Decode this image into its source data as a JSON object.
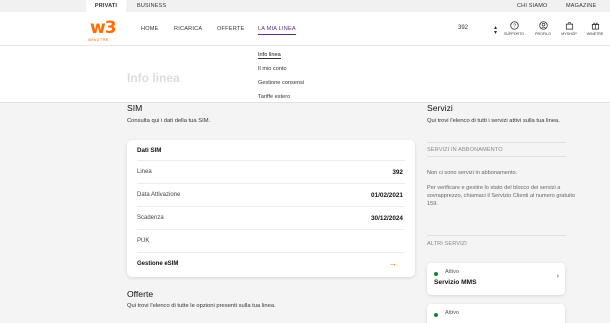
{
  "topbar": {
    "privati": "PRIVATI",
    "business": "BUSINESS",
    "chi_siamo": "CHI SIAMO",
    "magazine": "MAGAZINE"
  },
  "logo": {
    "mark": "w3",
    "word": "WINDTRE"
  },
  "nav": {
    "home": "HOME",
    "ricarica": "RICARICA",
    "offerte": "OFFERTE",
    "mia_linea": "LA MIA LINEA"
  },
  "number_selector": {
    "value": "392"
  },
  "icons": {
    "supporto": "SUPPORTO",
    "profilo": "PROFILO",
    "myshop": "MYSHOP",
    "winetre": "WINETRE"
  },
  "dropdown": {
    "items": [
      "Info linea",
      "Il mio conto",
      "Gestione consensi",
      "Tariffe estero"
    ],
    "selected": "Info linea"
  },
  "page_title_ghost": "Info linea",
  "sim": {
    "title": "SIM",
    "subtitle": "Consulta qui i dati della tua SIM.",
    "card_title": "Dati SIM",
    "rows": [
      {
        "label": "Linea",
        "value": "392"
      },
      {
        "label": "Data Attivazione",
        "value": "01/02/2021"
      },
      {
        "label": "Scadenza",
        "value": "30/12/2024"
      },
      {
        "label": "PUK",
        "value": ""
      }
    ],
    "esim_link": "Gestione eSIM"
  },
  "offerte": {
    "title": "Offerte",
    "subtitle": "Qui trovi l'elenco di tutte le opzioni presenti sulla tua linea."
  },
  "servizi": {
    "title": "Servizi",
    "subtitle": "Qui trovi l'elenco di tutti i servizi attivi sulla tua linea.",
    "abbonamento_label": "SERVIZI IN ABBONAMENTO",
    "no_services": "Non ci sono servizi in abbonamento.",
    "info": "Per verificare e gestire lo stato del blocco dei servizi a sovrapprezzo, chiamaci il Servizio Clienti al numero gratuito 159.",
    "altri_label": "ALTRI SERVIZI",
    "items": [
      {
        "status": "Attivo",
        "name": "Servizio MMS"
      },
      {
        "status": "Attivo",
        "name": ""
      }
    ]
  },
  "colors": {
    "brand": "#ff6c00",
    "accent": "#5b2a86",
    "active_dot": "#1a7f3c"
  }
}
